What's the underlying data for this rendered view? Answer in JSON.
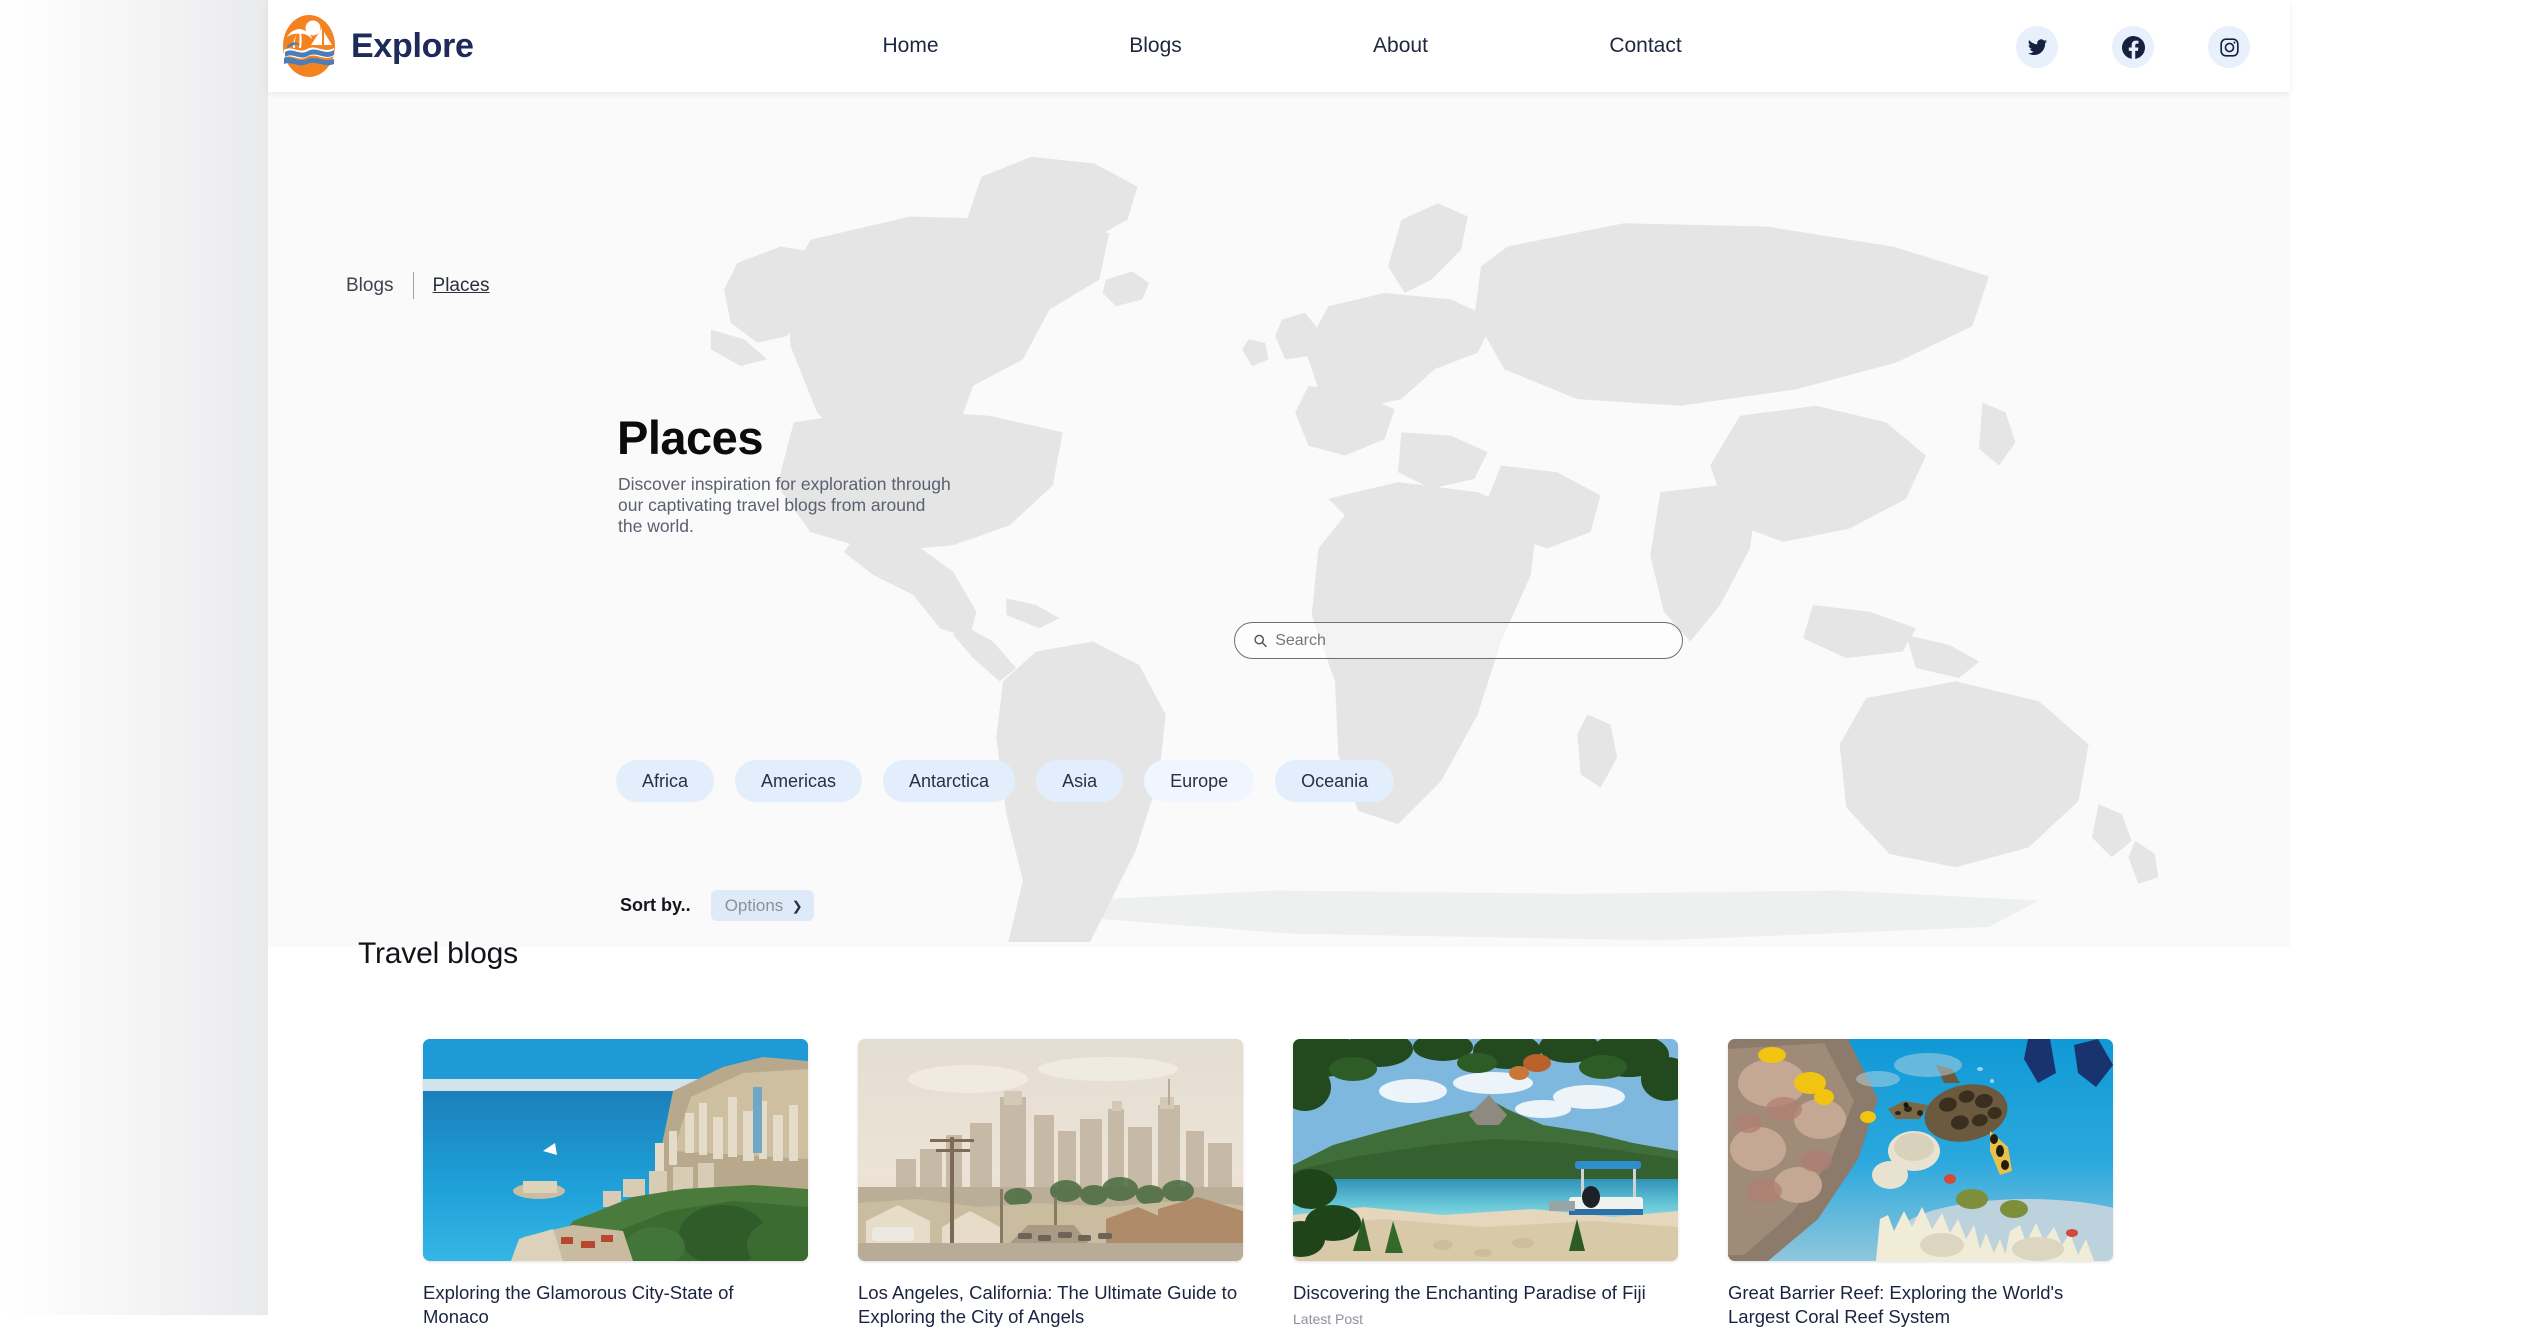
{
  "header": {
    "brand_name": "Explore",
    "logo_icon": "explore-beach-logo",
    "nav": [
      {
        "label": "Home"
      },
      {
        "label": "Blogs"
      },
      {
        "label": "About"
      },
      {
        "label": "Contact"
      }
    ],
    "socials": [
      {
        "name": "twitter-icon",
        "label": "Twitter"
      },
      {
        "name": "facebook-icon",
        "label": "Facebook"
      },
      {
        "name": "instagram-icon",
        "label": "Instagram"
      }
    ],
    "social_bg": "#e8f0fb"
  },
  "hero": {
    "breadcrumb": {
      "root": "Blogs",
      "current": "Places"
    },
    "title": "Places",
    "description": "Discover inspiration for exploration through our captivating travel blogs from around the world.",
    "background": "world-map",
    "search": {
      "placeholder": "Search",
      "value": "",
      "icon": "search-icon"
    },
    "chips": [
      {
        "label": "Africa",
        "active": false
      },
      {
        "label": "Americas",
        "active": false
      },
      {
        "label": "Antarctica",
        "active": false
      },
      {
        "label": "Asia",
        "active": false
      },
      {
        "label": "Europe",
        "active": true
      },
      {
        "label": "Oceania",
        "active": false
      }
    ],
    "sort": {
      "label": "Sort by..",
      "selected": "Options",
      "options": [
        "Options"
      ],
      "chevron_icon": "chevron-down-icon"
    }
  },
  "blogs": {
    "section_title": "Travel blogs",
    "cards": [
      {
        "title": "Exploring the Glamorous City-State of Monaco",
        "subtitle": "",
        "image": "monaco-coastline"
      },
      {
        "title": "Los Angeles, California: The Ultimate Guide to Exploring the City of Angels",
        "subtitle": "",
        "image": "los-angeles-skyline"
      },
      {
        "title": "Discovering the Enchanting Paradise of Fiji",
        "subtitle": "Latest Post",
        "image": "fiji-beach"
      },
      {
        "title": "Great Barrier Reef: Exploring the World's Largest Coral Reef System",
        "subtitle": "",
        "image": "great-barrier-reef"
      }
    ]
  },
  "colors": {
    "brand_navy": "#1e2a5a",
    "logo_orange": "#f58220",
    "chip_blue": "#e3eefc",
    "hero_bg": "#fafafa"
  }
}
